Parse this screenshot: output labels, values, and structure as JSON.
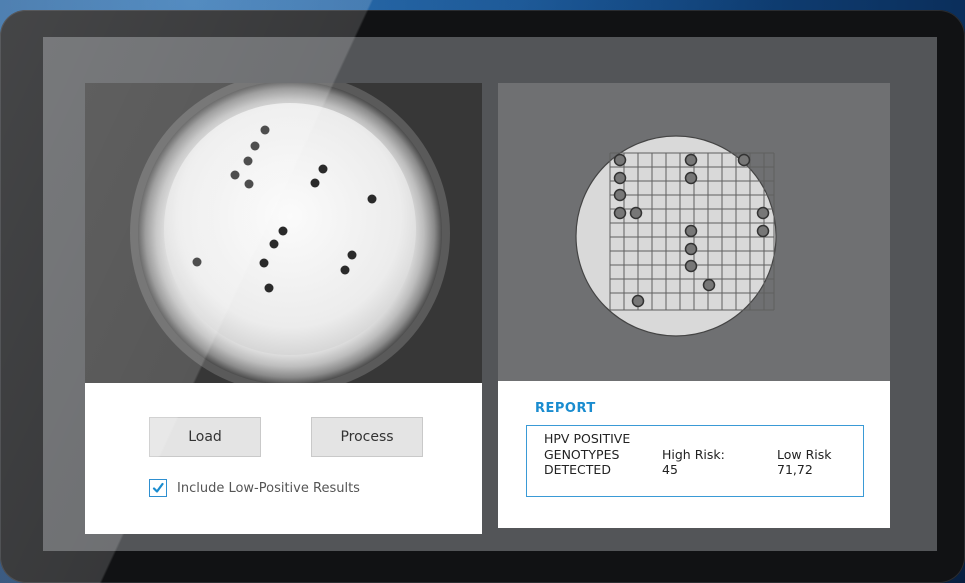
{
  "left_panel": {
    "load_button": "Load",
    "process_button": "Process",
    "include_checkbox": {
      "label": "Include Low-Positive Results",
      "checked": true
    }
  },
  "right_panel": {
    "report_title": "REPORT",
    "report": {
      "line1": "HPV POSITIVE",
      "line2": "GENOTYPES",
      "line3": "DETECTED",
      "high_risk_label": "High Risk:",
      "high_risk_value": "45",
      "low_risk_label": "Low Risk",
      "low_risk_value": "71,72"
    }
  },
  "colors": {
    "accent": "#1a8ccf",
    "screen": "#535558",
    "bezel": "#111214"
  },
  "icons": {
    "checkbox": "checkmark-icon"
  }
}
